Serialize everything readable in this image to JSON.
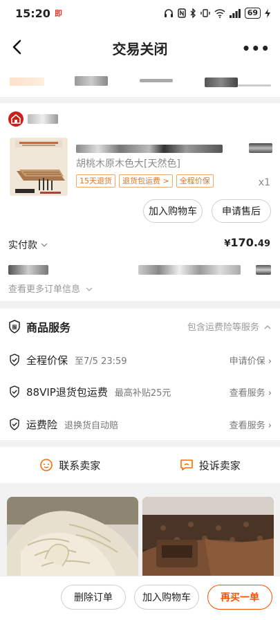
{
  "status_bar": {
    "time": "15:20",
    "carrier_glyph": "即",
    "battery": "69",
    "icons": [
      "headphones-icon",
      "nfc-icon",
      "bluetooth-icon",
      "vibrate-icon",
      "wifi-icon",
      "signal-icon",
      "battery-icon",
      "charging-icon"
    ]
  },
  "header": {
    "title": "交易关闭",
    "more": "•••"
  },
  "order": {
    "product_spec": "胡桃木原木色大[天然色]",
    "tags": [
      "15天退货",
      "退货包运费 >",
      "全程价保"
    ],
    "quantity": "x1",
    "add_to_cart": "加入购物车",
    "after_sales": "申请售后",
    "paid_label": "实付款",
    "price_symbol": "¥",
    "price_int": "170.",
    "price_dec": "49",
    "more_info": "查看更多订单信息"
  },
  "services": {
    "title": "商品服务",
    "summary": "包含运费险等服务",
    "items": [
      {
        "name": "全程价保",
        "sub": "至7/5 23:59",
        "action": "申请价保"
      },
      {
        "name": "88VIP退货包运费",
        "sub": "最高补贴25元",
        "action": "查看服务"
      },
      {
        "name": "运费险",
        "sub": "退换货自动赔",
        "action": "查看服务"
      }
    ]
  },
  "contact": {
    "contact_seller": "联系卖家",
    "complain_seller": "投诉卖家"
  },
  "bottom": {
    "delete_order": "删除订单",
    "add_to_cart": "加入购物车",
    "buy_again": "再买一单"
  },
  "colors": {
    "accent": "#ff5000",
    "tag_border": "#f0a868",
    "tag_text": "#e8741e"
  }
}
